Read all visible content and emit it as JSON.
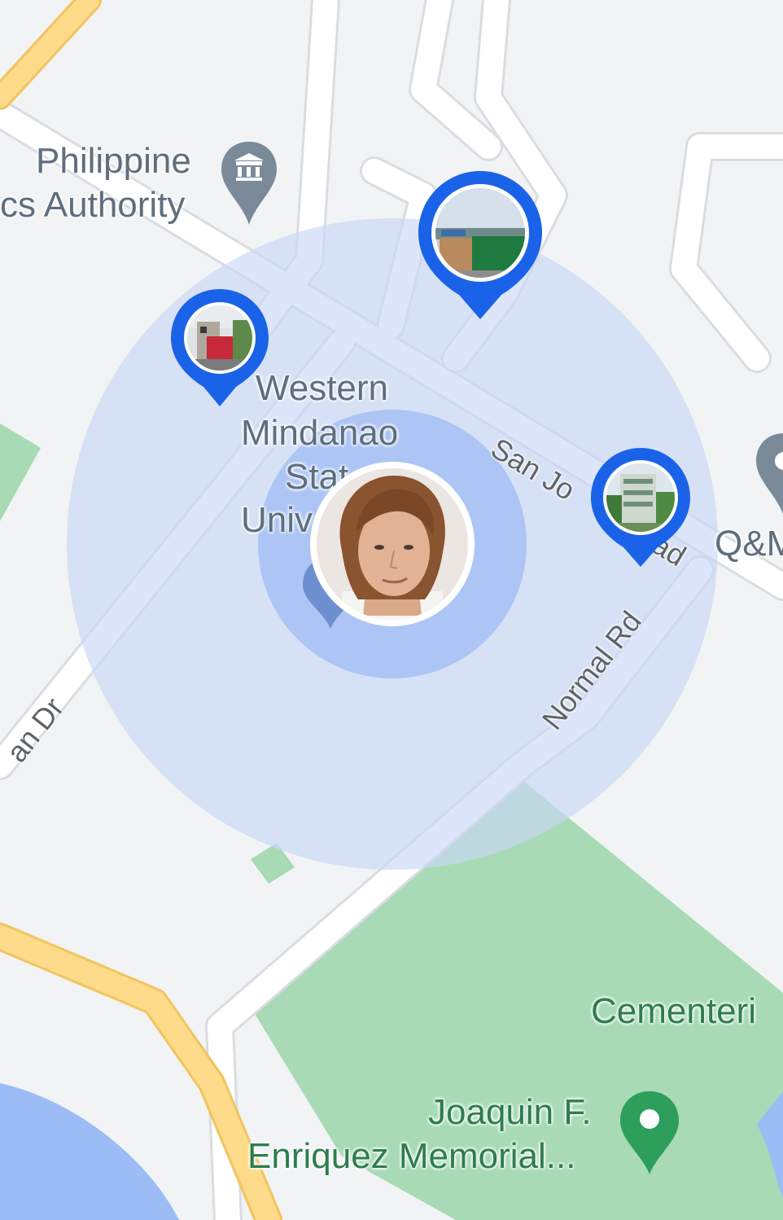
{
  "map": {
    "labels": {
      "philippine_line1": "Philippine",
      "philippine_line2": "cs Authority",
      "wmsu_line1": "Western",
      "wmsu_line2": "Mindanao",
      "wmsu_line3": "Stat",
      "wmsu_line4": "Univ",
      "san_jose": "San Jo",
      "san_jose_end": "ad",
      "normal_rd": "Normal Rd",
      "san_dr": "an Dr",
      "qm": "Q&M",
      "cementerio": "Cementeri",
      "joaquin_line1": "Joaquin F.",
      "joaquin_line2": "Enriquez Memorial..."
    },
    "markers": [
      {
        "name": "photo-pin-left",
        "icon": "building-photo"
      },
      {
        "name": "photo-pin-top",
        "icon": "building-photo"
      },
      {
        "name": "photo-pin-right",
        "icon": "building-photo"
      }
    ],
    "user_location": {
      "icon": "user-avatar-photo"
    },
    "colors": {
      "pin_blue": "#1a63e8",
      "radius_outer": "#c9d7f6",
      "radius_inner": "#a5c0f5",
      "park_green": "#a8dab5",
      "water_blue": "#9bbcf5",
      "highway_yellow": "#fddb8a"
    }
  }
}
